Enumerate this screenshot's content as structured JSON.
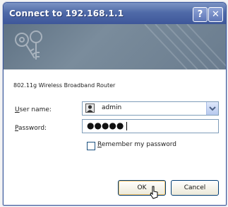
{
  "window": {
    "title": "Connect to 192.168.1.1",
    "help_symbol": "?",
    "close_symbol": "✕"
  },
  "dialog": {
    "router_text": "802.11g Wireless Broadband Router",
    "username_label_u": "U",
    "username_label_rest": "ser name:",
    "username_value": "admin",
    "password_label_p": "P",
    "password_label_rest": "assword:",
    "password_masked": "●●●●●",
    "remember_label_r": "R",
    "remember_label_rest": "emember my password",
    "remember_checked": false
  },
  "buttons": {
    "ok_label": "OK",
    "cancel_label": "Cancel"
  },
  "icons": {
    "banner": "keys-icon",
    "user": "user-icon",
    "dropdown": "chevron-down-icon",
    "cursor": "pointer-cursor-icon"
  }
}
